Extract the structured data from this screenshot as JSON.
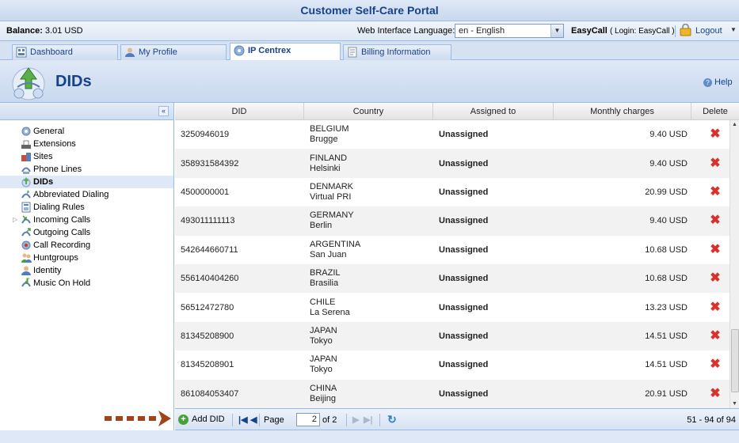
{
  "app": {
    "title": "Customer Self-Care Portal"
  },
  "infobar": {
    "balance_label": "Balance:",
    "balance_value": "3.01 USD",
    "language_label": "Web Interface Language:",
    "language_value": "en - English",
    "user_name": "EasyCall",
    "user_login": "( Login: EasyCall )",
    "logout": "Logout"
  },
  "tabs": [
    {
      "label": "Dashboard",
      "icon": "dashboard-icon"
    },
    {
      "label": "My Profile",
      "icon": "profile-icon"
    },
    {
      "label": "IP Centrex",
      "icon": "ip-centrex-icon",
      "active": true
    },
    {
      "label": "Billing Information",
      "icon": "billing-icon"
    }
  ],
  "header": {
    "title": "DIDs",
    "help": "Help"
  },
  "sidebar": {
    "items": [
      {
        "label": "General",
        "icon": "gear-icon"
      },
      {
        "label": "Extensions",
        "icon": "extensions-icon"
      },
      {
        "label": "Sites",
        "icon": "sites-icon"
      },
      {
        "label": "Phone Lines",
        "icon": "phone-lines-icon"
      },
      {
        "label": "DIDs",
        "icon": "dids-icon",
        "selected": true
      },
      {
        "label": "Abbreviated Dialing",
        "icon": "abbreviated-dialing-icon"
      },
      {
        "label": "Dialing Rules",
        "icon": "dialing-rules-icon"
      },
      {
        "label": "Incoming Calls",
        "icon": "incoming-calls-icon",
        "expandable": true
      },
      {
        "label": "Outgoing Calls",
        "icon": "outgoing-calls-icon"
      },
      {
        "label": "Call Recording",
        "icon": "call-recording-icon"
      },
      {
        "label": "Huntgroups",
        "icon": "huntgroups-icon"
      },
      {
        "label": "Identity",
        "icon": "identity-icon"
      },
      {
        "label": "Music On Hold",
        "icon": "music-on-hold-icon"
      }
    ]
  },
  "grid": {
    "columns": [
      "DID",
      "Country",
      "Assigned to",
      "Monthly charges",
      "Delete"
    ],
    "rows": [
      {
        "did": "3250946019",
        "country": "BELGIUM",
        "city": "Brugge",
        "assigned": "Unassigned",
        "charges": "9.40 USD"
      },
      {
        "did": "358931584392",
        "country": "FINLAND",
        "city": "Helsinki",
        "assigned": "Unassigned",
        "charges": "9.40 USD"
      },
      {
        "did": "4500000001",
        "country": "DENMARK",
        "city": "Virtual PRI",
        "assigned": "Unassigned",
        "charges": "20.99 USD"
      },
      {
        "did": "493011111113",
        "country": "GERMANY",
        "city": "Berlin",
        "assigned": "Unassigned",
        "charges": "9.40 USD"
      },
      {
        "did": "542644660711",
        "country": "ARGENTINA",
        "city": "San Juan",
        "assigned": "Unassigned",
        "charges": "10.68 USD"
      },
      {
        "did": "556140404260",
        "country": "BRAZIL",
        "city": "Brasilia",
        "assigned": "Unassigned",
        "charges": "10.68 USD"
      },
      {
        "did": "56512472780",
        "country": "CHILE",
        "city": "La Serena",
        "assigned": "Unassigned",
        "charges": "13.23 USD"
      },
      {
        "did": "81345208900",
        "country": "JAPAN",
        "city": "Tokyo",
        "assigned": "Unassigned",
        "charges": "14.51 USD"
      },
      {
        "did": "81345208901",
        "country": "JAPAN",
        "city": "Tokyo",
        "assigned": "Unassigned",
        "charges": "14.51 USD"
      },
      {
        "did": "861084053407",
        "country": "CHINA",
        "city": "Beijing",
        "assigned": "Unassigned",
        "charges": "20.91 USD"
      }
    ]
  },
  "pager": {
    "add_label": "Add DID",
    "page_label": "Page",
    "page_value": "2",
    "of_label": "of 2",
    "range": "51 - 94 of 94"
  },
  "colors": {
    "accent": "#15428b",
    "border": "#99bbe8",
    "delete": "#d9312b",
    "add": "#4a9e3c",
    "arrow": "#a0441a"
  }
}
